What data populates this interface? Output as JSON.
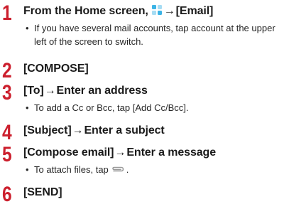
{
  "steps": [
    {
      "number": "1",
      "title_prefix": "From the Home screen,",
      "title_icon": "apps-grid-icon",
      "arrow": "→",
      "title_suffix": "[Email]",
      "note": "If you have several mail accounts, tap account at the upper left of the screen to switch."
    },
    {
      "number": "2",
      "title": "[COMPOSE]"
    },
    {
      "number": "3",
      "title_prefix": "[To]",
      "arrow": "→",
      "title_suffix": "Enter an address",
      "note": "To add a Cc or Bcc, tap [Add Cc/Bcc]."
    },
    {
      "number": "4",
      "title_prefix": "[Subject]",
      "arrow": "→",
      "title_suffix": "Enter a subject"
    },
    {
      "number": "5",
      "title_prefix": "[Compose email]",
      "arrow": "→",
      "title_suffix": "Enter a message",
      "note_prefix": "To attach files, tap",
      "note_icon": "paperclip-icon",
      "note_suffix": "."
    },
    {
      "number": "6",
      "title": "[SEND]"
    }
  ],
  "bullet": "•",
  "colors": {
    "step_number": "#cc1f2d",
    "text": "#1a1a1a",
    "icon_blue": "#3cb4e6",
    "icon_light": "#a6dcf3",
    "clip_gray": "#9a9a9a"
  }
}
